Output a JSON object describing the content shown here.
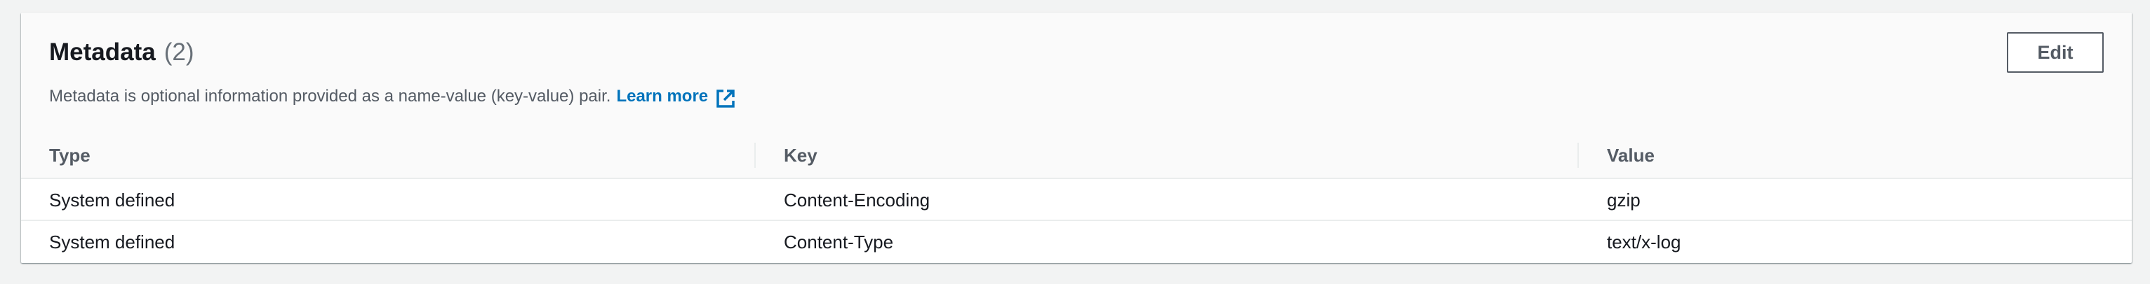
{
  "panel": {
    "title": "Metadata",
    "count": "(2)",
    "description": "Metadata is optional information provided as a name-value (key-value) pair.",
    "learn_more": "Learn more",
    "edit_label": "Edit"
  },
  "table": {
    "columns": [
      "Type",
      "Key",
      "Value"
    ],
    "rows": [
      [
        "System defined",
        "Content-Encoding",
        "gzip"
      ],
      [
        "System defined",
        "Content-Type",
        "text/x-log"
      ]
    ]
  },
  "icons": {
    "external_link": "external-link-icon"
  },
  "colors": {
    "link": "#0073bb",
    "text": "#16191f",
    "secondary_text": "#545b64",
    "header_bg": "#fafafa",
    "page_bg": "#f2f3f3",
    "divider": "#eaeded"
  }
}
